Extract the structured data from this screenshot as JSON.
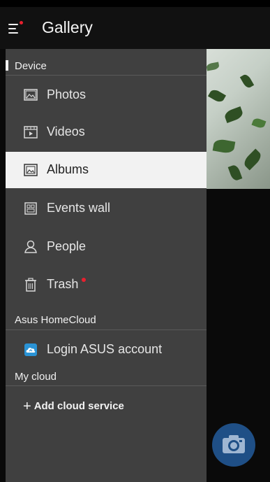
{
  "app": {
    "title": "Gallery"
  },
  "colors": {
    "accent_red": "#e8202e",
    "fab": "#1f4f86",
    "cloud_icon": "#2a93d5"
  },
  "sections": {
    "device": "Device",
    "homecloud": "Asus HomeCloud",
    "mycloud": "My cloud"
  },
  "device_items": [
    {
      "label": "Photos",
      "icon": "photo-icon"
    },
    {
      "label": "Videos",
      "icon": "video-icon"
    },
    {
      "label": "Albums",
      "icon": "album-icon",
      "selected": true
    },
    {
      "label": "Events wall",
      "icon": "events-icon"
    },
    {
      "label": "People",
      "icon": "people-icon"
    },
    {
      "label": "Trash",
      "icon": "trash-icon",
      "badge": true
    }
  ],
  "homecloud_items": [
    {
      "label": "Login ASUS account",
      "icon": "asus-cloud-icon"
    }
  ],
  "mycloud": {
    "add_label": "Add cloud service"
  }
}
